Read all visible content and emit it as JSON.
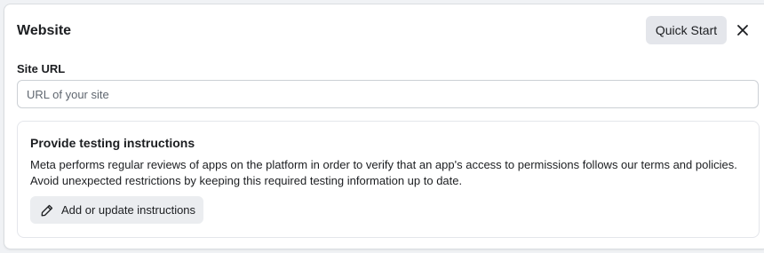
{
  "header": {
    "title": "Website",
    "quick_start_label": "Quick Start",
    "close_icon": "close-icon"
  },
  "site_url": {
    "label": "Site URL",
    "value": "",
    "placeholder": "URL of your site"
  },
  "testing": {
    "title": "Provide testing instructions",
    "description_line1": "Meta performs regular reviews of apps on the platform in order to verify that an app's access to permissions follows our terms and policies.",
    "description_line2": "Avoid unexpected restrictions by keeping this required testing information up to date.",
    "button_label": "Add or update instructions",
    "button_icon": "pencil-icon"
  },
  "colors": {
    "page_background": "#f0f2f5",
    "panel_background": "#ffffff",
    "button_background": "#e4e6eb",
    "text_primary": "#1c1e21",
    "placeholder": "#606770",
    "border": "#ccd0d5"
  }
}
